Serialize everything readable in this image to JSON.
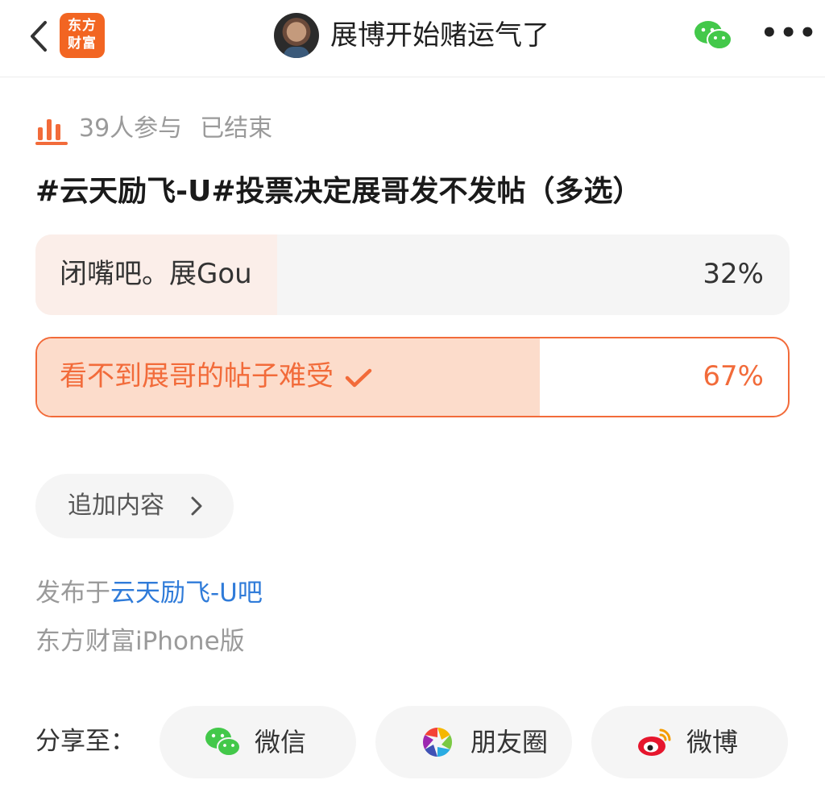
{
  "header": {
    "logo_line1": "东方",
    "logo_line2": "财富",
    "title": "展博开始赌运气了",
    "more_glyph": "•••"
  },
  "poll": {
    "participants": "39人参与",
    "status": "已结束",
    "question": "#云天励飞-U#投票决定展哥发不发帖（多选）",
    "options": [
      {
        "label": "闭嘴吧。展Gou",
        "percent_text": "32%",
        "percent": 32,
        "selected": false
      },
      {
        "label": "看不到展哥的帖子难受",
        "percent_text": "67%",
        "percent": 67,
        "selected": true
      }
    ],
    "append_label": "追加内容"
  },
  "footer": {
    "published_prefix": "发布于",
    "published_link": "云天励飞-U吧",
    "platform": "东方财富iPhone版"
  },
  "share": {
    "label": "分享至：",
    "wechat": "微信",
    "moments": "朋友圈",
    "weibo": "微博"
  },
  "colors": {
    "accent": "#f26b3a",
    "brand": "#f26522",
    "link": "#2f7bd9",
    "wechat_green": "#43c84a"
  },
  "icons": [
    "back-arrow-icon",
    "brand-logo",
    "avatar",
    "wechat-icon",
    "more-icon",
    "bar-chart-icon",
    "checkmark-icon",
    "chevron-right-icon",
    "moments-icon",
    "weibo-icon"
  ]
}
